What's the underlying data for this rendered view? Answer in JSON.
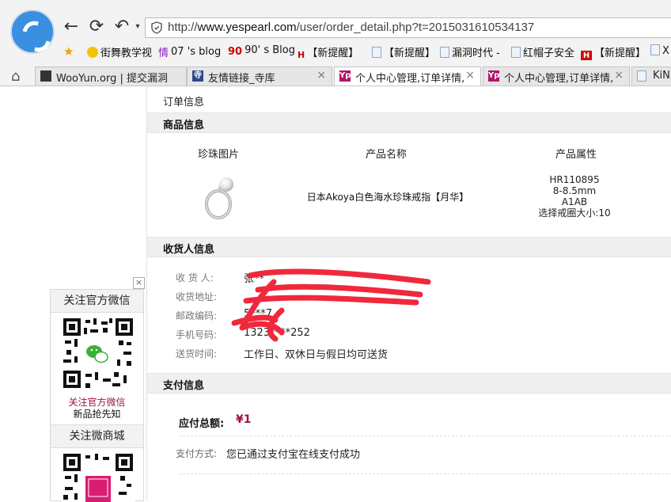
{
  "browser": {
    "url_prefix": "http://",
    "url_host": "www.yespearl.com",
    "url_path": "/user/order_detail.php?t=2015031610534137",
    "bookmarks": [
      {
        "label": "街舞教学视"
      },
      {
        "label": "07 's blog"
      },
      {
        "label": "90' s Blog"
      },
      {
        "label": "【新提醒】"
      },
      {
        "label": "【新提醒】"
      },
      {
        "label": "漏洞时代 -"
      },
      {
        "label": "红帽子安全"
      },
      {
        "label": "【新提醒】"
      },
      {
        "label": "X"
      }
    ],
    "tabs": [
      {
        "label": "WooYun.org | 提交漏洞"
      },
      {
        "label": "友情链接_寺库"
      },
      {
        "label": "个人中心管理,订单详情,"
      },
      {
        "label": "个人中心管理,订单详情,"
      },
      {
        "label": "KiN"
      }
    ],
    "tab_icon_letters": {
      "yp": "Yp",
      "siku": "寺"
    }
  },
  "page": {
    "breadcrumb": "订单信息",
    "product_section": "商品信息",
    "col_image": "珍珠图片",
    "col_name": "产品名称",
    "col_attr": "产品属性",
    "product_name": "日本Akoya白色海水珍珠戒指【月华】",
    "product_attrs": [
      "HR110895",
      "8-8.5mm",
      "A1AB",
      "选择戒圈大小:10"
    ],
    "receiver_section": "收货人信息",
    "fields": [
      {
        "label": "收 货 人:",
        "value": "张**"
      },
      {
        "label": "收货地址:",
        "value": ""
      },
      {
        "label": "邮政编码:",
        "value": "5***7"
      },
      {
        "label": "手机号码:",
        "value": "1323****252"
      },
      {
        "label": "送货时间:",
        "value": "工作日、双休日与假日均可送货"
      }
    ],
    "payment_section": "支付信息",
    "total_label": "应付总额:",
    "total_value": "¥1",
    "pay_method_label": "支付方式:",
    "pay_method_value": "您已通过支付宝在线支付成功"
  },
  "float": {
    "close": "×",
    "title1": "关注官方微信",
    "caption1": "关注官方微信",
    "caption2": "新品抢先知",
    "title2": "关注微商城"
  }
}
